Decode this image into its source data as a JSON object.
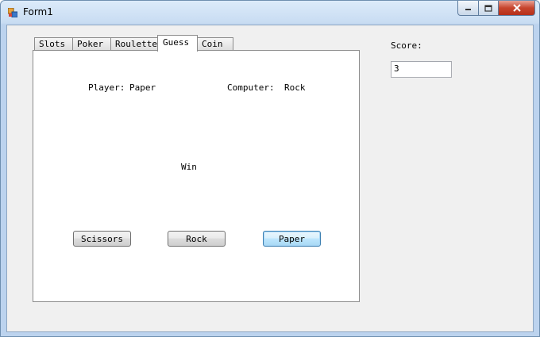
{
  "window": {
    "title": "Form1",
    "caption_buttons": {
      "minimize": "minimize",
      "maximize": "maximize",
      "close": "close"
    }
  },
  "tabs": [
    {
      "label": "Slots",
      "active": false
    },
    {
      "label": "Poker",
      "active": false
    },
    {
      "label": "Roulette",
      "active": false
    },
    {
      "label": "Guess",
      "active": true
    },
    {
      "label": "Coin",
      "active": false
    }
  ],
  "guess": {
    "player_label": "Player:",
    "player_value": "Paper",
    "computer_label": "Computer:",
    "computer_value": "Rock",
    "result": "Win",
    "buttons": {
      "scissors": "Scissors",
      "rock": "Rock",
      "paper": "Paper"
    }
  },
  "score": {
    "label": "Score:",
    "value": "3"
  },
  "colors": {
    "client_bg": "#f0f0f0",
    "focus_border": "#3c7fb1",
    "close_button": "#c7452d"
  }
}
